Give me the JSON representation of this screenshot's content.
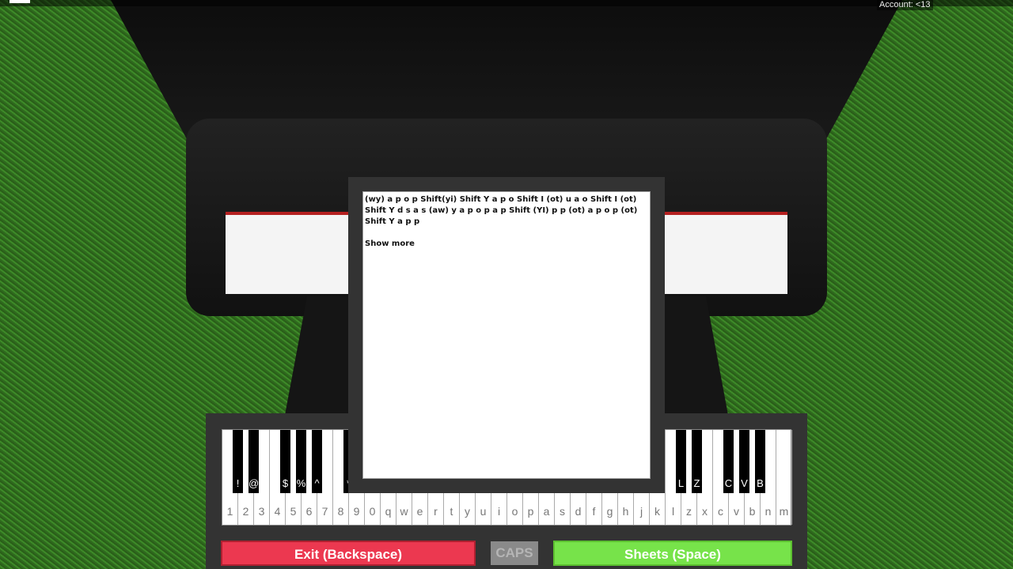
{
  "topbar": {
    "account": "Account: <13"
  },
  "sheet": {
    "text": "(wy) a p o p Shift(yi) Shift Y a p o Shift I (ot) u a o Shift I (ot) Shift Y d s  a s (aw) y a p o p a p Shift (YI) p p (ot) a p o p (ot) Shift Y a p p",
    "show_more": "Show more"
  },
  "keyboard": {
    "white": [
      "1",
      "2",
      "3",
      "4",
      "5",
      "6",
      "7",
      "8",
      "9",
      "0",
      "q",
      "w",
      "e",
      "r",
      "t",
      "y",
      "u",
      "i",
      "o",
      "p",
      "a",
      "s",
      "d",
      "f",
      "g",
      "h",
      "j",
      "k",
      "l",
      "z",
      "x",
      "c",
      "v",
      "b",
      "n",
      "m"
    ],
    "black": {
      "0": "!",
      "1": "@",
      "3": "$",
      "4": "%",
      "5": "^",
      "7": "*",
      "28": "L",
      "29": "Z",
      "31": "C",
      "32": "V",
      "33": "B"
    }
  },
  "buttons": {
    "exit": "Exit (Backspace)",
    "caps": "CAPS",
    "sheets": "Sheets (Space)"
  },
  "colors": {
    "exit": "#ec3850",
    "sheets": "#77e34a",
    "caps": "#8a8a8a"
  }
}
